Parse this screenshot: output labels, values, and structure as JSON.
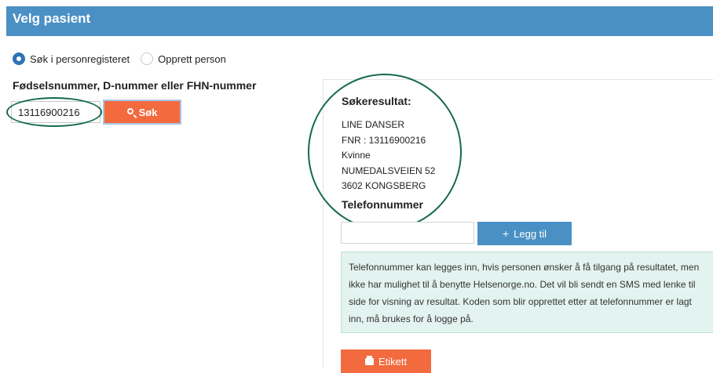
{
  "header": {
    "title": "Velg pasient"
  },
  "search_mode": {
    "options": [
      {
        "label": "Søk i personregisteret",
        "selected": true
      },
      {
        "label": "Opprett person",
        "selected": false
      }
    ]
  },
  "search": {
    "label": "Fødselsnummer, D-nummer eller FHN-nummer",
    "value": "13116900216",
    "button_label": "Søk",
    "button_icon": "search-icon"
  },
  "result": {
    "title": "Søkeresultat:",
    "lines": [
      "LINE DANSER",
      "FNR : 13116900216",
      "Kvinne",
      "NUMEDALSVEIEN 52",
      "3602 KONGSBERG"
    ]
  },
  "phone": {
    "title": "Telefonnummer",
    "value": "",
    "add_button_label": "Legg til",
    "add_button_icon": "plus-icon",
    "info_text": "Telefonnummer kan legges inn, hvis personen ønsker å få tilgang på resultatet, men ikke har mulighet til å benytte Helsenorge.no. Det vil bli sendt en SMS med lenke til side for visning av resultat. Koden som blir opprettet etter at telefonnummer er lagt inn, må brukes for å logge på."
  },
  "label_button": {
    "label": "Etikett",
    "icon": "printer-icon"
  },
  "colors": {
    "header": "#4a90c4",
    "primary_orange": "#f26a3e",
    "annotation_circle": "#136a4a",
    "info_background": "#e3f3ef"
  }
}
